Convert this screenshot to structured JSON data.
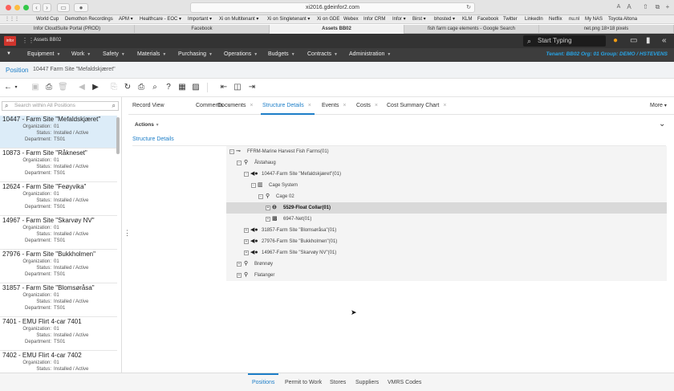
{
  "browser": {
    "url": "xi2016.gdeinfor2.com",
    "bookmarks": [
      "World Cup",
      "Demothon Recordings",
      "APM ▾",
      "Healthcare - EOC ▾",
      "Important ▾",
      "Xi on Multitenant ▾",
      "Xi on Singletenant ▾",
      "Xi on GDE",
      "Webex",
      "Infor CRM",
      "Infor ▾",
      "Birst ▾",
      "bhosted ▾",
      "KLM",
      "Facebook",
      "Twitter",
      "LinkedIn",
      "Netflix",
      "nu.nl",
      "My NAS",
      "Toyota Altona"
    ],
    "tabs": [
      "Infor CloudSuite Portal (PROD)",
      "Facebook",
      "Assets BB02",
      "fish farm cage elements - Google Search",
      "net.png 18×18 pixels"
    ]
  },
  "app": {
    "logo_text": "infor",
    "name": "Assets BB02",
    "search_placeholder": "Start Typing",
    "menu": [
      "Equipment",
      "Work",
      "Safety",
      "Materials",
      "Purchasing",
      "Operations",
      "Budgets",
      "Contracts",
      "Administration"
    ],
    "tenant": "Tenant: BB02  Org: 01  Group: DEMO / HSTEVENS"
  },
  "page": {
    "title": "Position",
    "record": "10447  Farm Site \"Mefaldskjæret\""
  },
  "left": {
    "search_placeholder": "Search within All Positions",
    "field_labels": {
      "org": "Organization:",
      "status": "Status:",
      "dept": "Department:"
    },
    "items": [
      {
        "title": "10447 - Farm Site \"Mefaldskjæret\"",
        "org": "01",
        "status": "Installed / Active",
        "dept": "TS01"
      },
      {
        "title": "10873 - Farm Site \"Råkneset\"",
        "org": "01",
        "status": "Installed / Active",
        "dept": "TS01"
      },
      {
        "title": "12624 - Farm Site \"Feøyvika\"",
        "org": "01",
        "status": "Installed / Active",
        "dept": "TS01"
      },
      {
        "title": "14967 - Farm Site \"Skarvøy NV\"",
        "org": "01",
        "status": "Installed / Active",
        "dept": "TS01"
      },
      {
        "title": "27976 - Farm Site \"Bukkholmen\"",
        "org": "01",
        "status": "Installed / Active",
        "dept": "TS01"
      },
      {
        "title": "31857 - Farm Site \"Blomsøråsa\"",
        "org": "01",
        "status": "Installed / Active",
        "dept": "TS01"
      },
      {
        "title": "7401 - EMU Flirt 4-car 7401",
        "org": "01",
        "status": "Installed / Active",
        "dept": "TS01"
      },
      {
        "title": "7402 - EMU Flirt 4-car 7402",
        "org": "01",
        "status": "Installed / Active",
        "dept": ""
      }
    ]
  },
  "main": {
    "tabs": [
      "Record View",
      "Comments",
      "Documents",
      "Structure Details",
      "Events",
      "Costs",
      "Cost Summary Chart"
    ],
    "more": "More",
    "actions": "Actions",
    "section_title": "Structure Details",
    "tree": [
      {
        "label": "FFRM-Marine Harvest Fish Farms(01)",
        "toggle": "−"
      },
      {
        "label": "Ålstahaug",
        "toggle": "−"
      },
      {
        "label": "10447-Farm Site \"Mefaldskjæret\"(01)",
        "toggle": "−"
      },
      {
        "label": "Cage System",
        "toggle": "−"
      },
      {
        "label": "Cage 02",
        "toggle": "−"
      },
      {
        "label": "5529-Float Collar(01)",
        "toggle": "+"
      },
      {
        "label": "6947-Net(01)",
        "toggle": "+"
      },
      {
        "label": "31857-Farm Site \"Blomsøråsa\"(01)",
        "toggle": "+"
      },
      {
        "label": "27976-Farm Site \"Bukkholmen\"(01)",
        "toggle": "+"
      },
      {
        "label": "14967-Farm Site \"Skarvøy NV\"(01)",
        "toggle": "+"
      },
      {
        "label": "Brønnøy",
        "toggle": "+"
      },
      {
        "label": "Flatanger",
        "toggle": "+"
      }
    ]
  },
  "footer": {
    "tabs": [
      "Positions",
      "Permit to Work",
      "Stores",
      "Suppliers",
      "VMRS Codes"
    ]
  },
  "colors": {
    "accent": "#1d7ec8",
    "header": "#333333",
    "tenant": "#27a5e8",
    "logo": "#d0342c"
  }
}
